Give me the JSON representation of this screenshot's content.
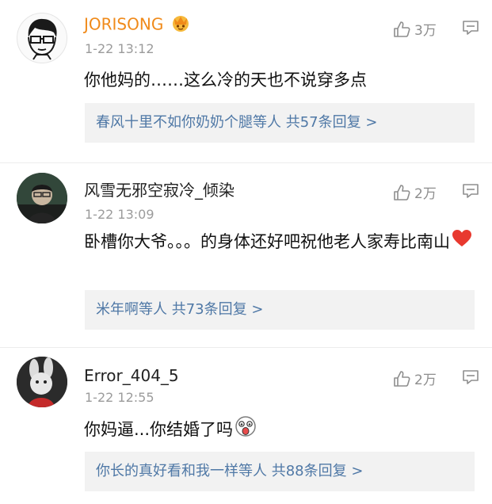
{
  "comments": [
    {
      "username": "JORISONG",
      "username_color": "#f08a1a",
      "badge_icon": "vip-crown-icon",
      "timestamp": "1-22 13:12",
      "likes": "3万",
      "text": "你他妈的……这么冷的天也不说穿多点",
      "reply_summary": "春风十里不如你奶奶个腿等人  共57条回复 >"
    },
    {
      "username": "风雪无邪空寂冷_倾染",
      "username_color": "#222222",
      "timestamp": "1-22 13:09",
      "likes": "2万",
      "text": "卧槽你大爷。。。的身体还好吧祝他老人家寿比南山",
      "emoji": "red-heart-icon",
      "reply_summary": "米年啊等人  共73条回复 >"
    },
    {
      "username": "Error_404_5",
      "username_color": "#222222",
      "timestamp": "1-22 12:55",
      "likes": "2万",
      "text": "你妈逼...你结婚了吗",
      "emoji": "shocked-face-icon",
      "reply_summary": "你长的真好看和我一样等人  共88条回复 >"
    }
  ],
  "colors": {
    "link_blue": "#4f78a6",
    "meta_gray": "#9b9b9b",
    "reply_bg": "#f2f2f2"
  }
}
